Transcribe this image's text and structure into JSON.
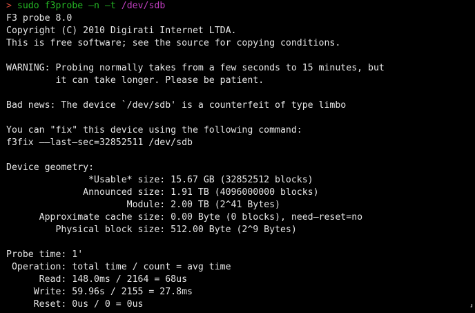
{
  "colors": {
    "background": "#000000",
    "foreground": "#e6e6e6",
    "prompt_arrow": "#d14a3a",
    "command": "#25b825",
    "argument_path": "#c23fc2"
  },
  "prompt": {
    "arrow": ">",
    "command": "sudo f3probe –n –t",
    "path": "/dev/sdb"
  },
  "output": {
    "version": "F3 probe 8.0",
    "copyright": "Copyright (C) 2010 Digirati Internet LTDA.",
    "license": "This is free software; see the source for copying conditions.",
    "warning_1": "WARNING: Probing normally takes from a few seconds to 15 minutes, but",
    "warning_2": "         it can take longer. Please be patient.",
    "bad_news": "Bad news: The device `/dev/sdb' is a counterfeit of type limbo",
    "fix_intro": "You can \"fix\" this device using the following command:",
    "fix_command": "f3fix ––last–sec=32852511 /dev/sdb",
    "geometry_title": "Device geometry:",
    "geometry": [
      "               *Usable* size: 15.67 GB (32852512 blocks)",
      "              Announced size: 1.91 TB (4096000000 blocks)",
      "                      Module: 2.00 TB (2^41 Bytes)",
      "      Approximate cache size: 0.00 Byte (0 blocks), need–reset=no",
      "         Physical block size: 512.00 Byte (2^9 Bytes)"
    ],
    "probe_time": "Probe time: 1'",
    "timing": [
      " Operation: total time / count = avg time",
      "      Read: 148.0ms / 2164 = 68us",
      "     Write: 59.96s / 2155 = 27.8ms",
      "     Reset: 0us / 0 = 0us"
    ]
  },
  "cursor_glyph": "⸥"
}
